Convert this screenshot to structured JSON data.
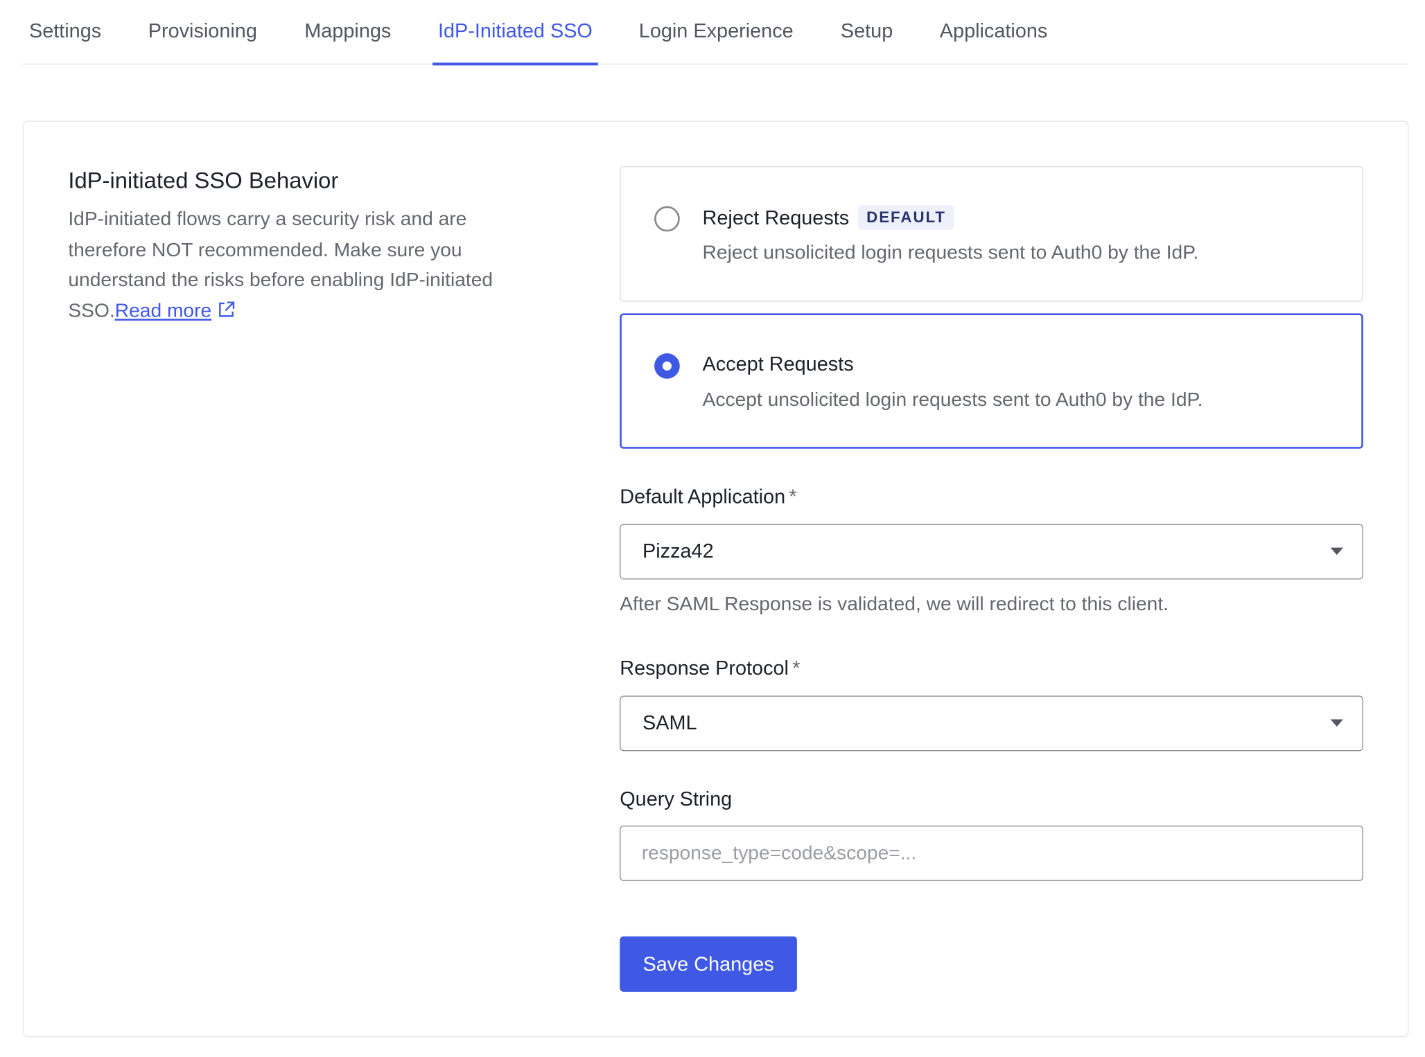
{
  "tabs": [
    {
      "label": "Settings",
      "active": false
    },
    {
      "label": "Provisioning",
      "active": false
    },
    {
      "label": "Mappings",
      "active": false
    },
    {
      "label": "IdP-Initiated SSO",
      "active": true
    },
    {
      "label": "Login Experience",
      "active": false
    },
    {
      "label": "Setup",
      "active": false
    },
    {
      "label": "Applications",
      "active": false
    }
  ],
  "section": {
    "title": "IdP-initiated SSO Behavior",
    "description": "IdP-initiated flows carry a security risk and are therefore NOT recommended. Make sure you understand the risks before enabling IdP-initiated SSO.",
    "read_more_label": "Read more",
    "read_more_icon": "external-link-icon"
  },
  "options": {
    "reject": {
      "title": "Reject Requests",
      "badge": "DEFAULT",
      "description": "Reject unsolicited login requests sent to Auth0 by the IdP.",
      "selected": false
    },
    "accept": {
      "title": "Accept Requests",
      "description": "Accept unsolicited login requests sent to Auth0 by the IdP.",
      "selected": true
    }
  },
  "form": {
    "default_application": {
      "label": "Default Application",
      "required_mark": "*",
      "value": "Pizza42",
      "helper": "After SAML Response is validated, we will redirect to this client."
    },
    "response_protocol": {
      "label": "Response Protocol",
      "required_mark": "*",
      "value": "SAML"
    },
    "query_string": {
      "label": "Query String",
      "value": "",
      "placeholder": "response_type=code&scope=..."
    },
    "save_label": "Save Changes"
  },
  "colors": {
    "accent": "#3f59e4",
    "text_primary": "#1e212a",
    "text_secondary": "#65676e",
    "border": "#e3e5ea",
    "badge_bg": "#eef1fc"
  }
}
